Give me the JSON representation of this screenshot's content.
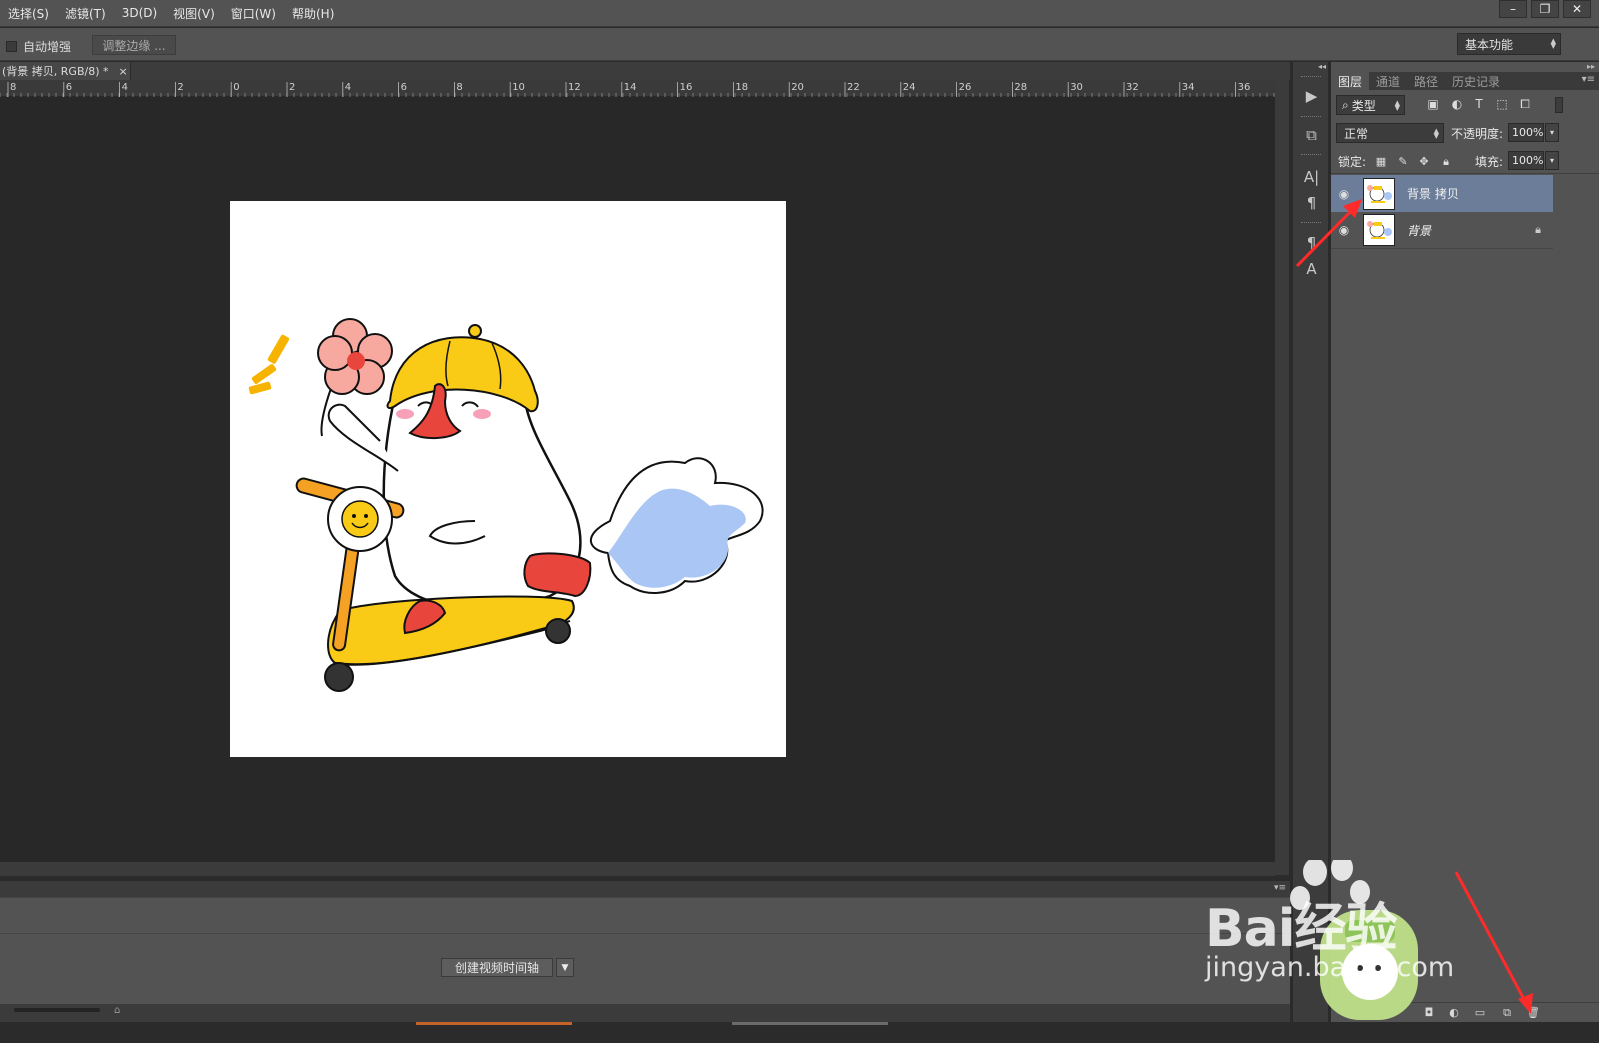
{
  "menu": {
    "items": [
      "选择(S)",
      "滤镜(T)",
      "3D(D)",
      "视图(V)",
      "窗口(W)",
      "帮助(H)"
    ],
    "window_controls": [
      "minimize",
      "restore",
      "close"
    ]
  },
  "options": {
    "auto_enhance_label": "自动增强",
    "auto_enhance_checked": false,
    "refine_edge_label": "调整边缘 ...",
    "workspace_label": "基本功能"
  },
  "document": {
    "tab_title": "(背景 拷贝, RGB/8) *",
    "tab_close": "×"
  },
  "ruler": {
    "labels": [
      "8",
      "6",
      "4",
      "2",
      "0",
      "2",
      "4",
      "6",
      "8",
      "10",
      "12",
      "14",
      "16",
      "18",
      "20",
      "22",
      "24",
      "26",
      "28",
      "30",
      "32",
      "34",
      "36"
    ]
  },
  "timeline": {
    "create_video_label": "创建视频时间轴"
  },
  "layers_panel": {
    "tabs": [
      {
        "label": "图层",
        "active": true
      },
      {
        "label": "通道",
        "active": false
      },
      {
        "label": "路径",
        "active": false
      },
      {
        "label": "历史记录",
        "active": false
      }
    ],
    "filter_kind": "类型",
    "blend_mode": "正常",
    "opacity_label": "不透明度:",
    "opacity_value": "100%",
    "lock_label": "锁定:",
    "fill_label": "填充:",
    "fill_value": "100%",
    "layers": [
      {
        "name": "背景 拷贝",
        "visible": true,
        "selected": true,
        "locked": false
      },
      {
        "name": "背景",
        "visible": true,
        "selected": false,
        "locked": true
      }
    ]
  },
  "watermark": {
    "brand": "Bai经验",
    "url": "jingyan.baidu.com"
  },
  "colors": {
    "ui_bg": "#535353",
    "canvas_bg": "#282828",
    "selected_layer": "#6b7d98",
    "annotation_arrow": "#ff2a2a"
  }
}
